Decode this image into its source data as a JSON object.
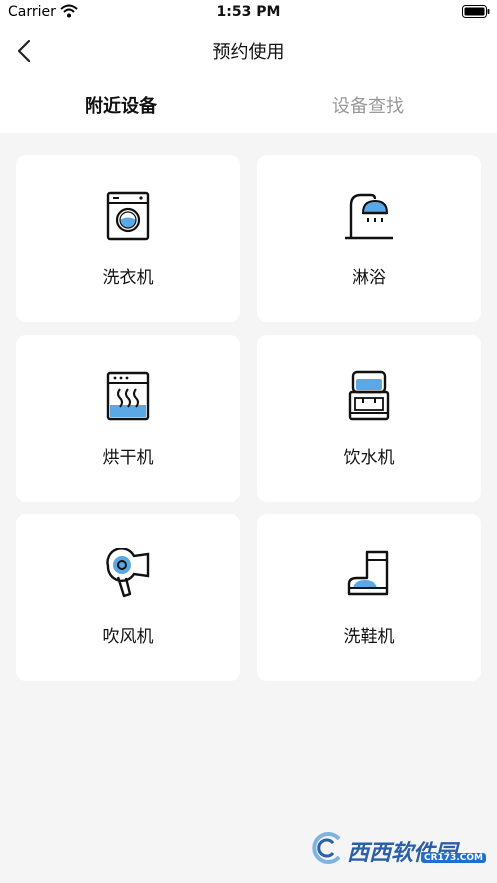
{
  "status_bar": {
    "carrier": "Carrier",
    "time": "1:53 PM"
  },
  "nav": {
    "title": "预约使用"
  },
  "tabs": [
    {
      "label": "附近设备",
      "active": true
    },
    {
      "label": "设备查找",
      "active": false
    }
  ],
  "devices": [
    {
      "label": "洗衣机",
      "icon": "washing-machine-icon"
    },
    {
      "label": "淋浴",
      "icon": "shower-icon"
    },
    {
      "label": "烘干机",
      "icon": "dryer-icon"
    },
    {
      "label": "饮水机",
      "icon": "water-dispenser-icon"
    },
    {
      "label": "吹风机",
      "icon": "hair-dryer-icon"
    },
    {
      "label": "洗鞋机",
      "icon": "shoe-washer-icon"
    }
  ],
  "watermark": {
    "text": "西西软件园",
    "sub": "CR173.COM"
  },
  "colors": {
    "accent": "#5aa9e6",
    "line": "#111111",
    "tab_inactive": "#999999",
    "background": "#f5f5f5"
  }
}
